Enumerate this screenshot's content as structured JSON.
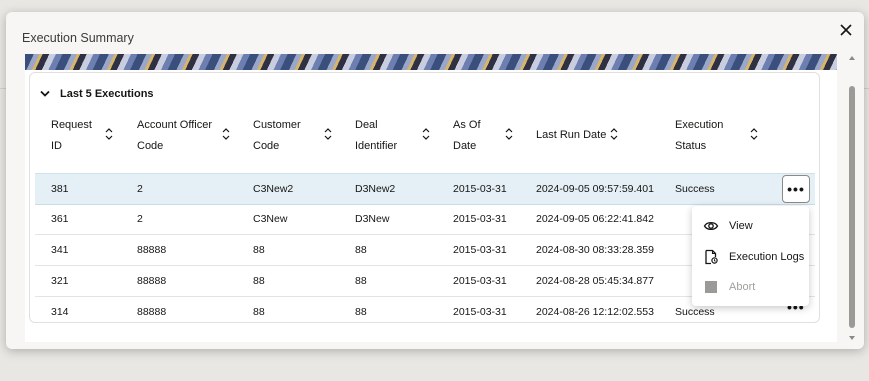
{
  "dialog": {
    "title": "Execution Summary",
    "section_title": "Last 5 Executions"
  },
  "table": {
    "columns": [
      {
        "label_line1": "Request",
        "label_line2": "ID"
      },
      {
        "label_line1": "Account Officer",
        "label_line2": "Code"
      },
      {
        "label_line1": "Customer",
        "label_line2": "Code"
      },
      {
        "label_line1": "Deal",
        "label_line2": "Identifier"
      },
      {
        "label_line1": "As Of",
        "label_line2": "Date"
      },
      {
        "label_line1": "Last Run Date",
        "label_line2": ""
      },
      {
        "label_line1": "Execution",
        "label_line2": "Status"
      }
    ],
    "rows": [
      {
        "request_id": "381",
        "account_officer_code": "2",
        "customer_code": "C3New2",
        "deal_identifier": "D3New2",
        "as_of_date": "2015-03-31",
        "last_run_date": "2024-09-05 09:57:59.401",
        "status": "Success",
        "selected": true
      },
      {
        "request_id": "361",
        "account_officer_code": "2",
        "customer_code": "C3New",
        "deal_identifier": "D3New",
        "as_of_date": "2015-03-31",
        "last_run_date": "2024-09-05 06:22:41.842",
        "status": ""
      },
      {
        "request_id": "341",
        "account_officer_code": "88888",
        "customer_code": "88",
        "deal_identifier": "88",
        "as_of_date": "2015-03-31",
        "last_run_date": "2024-08-30 08:33:28.359",
        "status": ""
      },
      {
        "request_id": "321",
        "account_officer_code": "88888",
        "customer_code": "88",
        "deal_identifier": "88",
        "as_of_date": "2015-03-31",
        "last_run_date": "2024-08-28 05:45:34.877",
        "status": ""
      },
      {
        "request_id": "314",
        "account_officer_code": "88888",
        "customer_code": "88",
        "deal_identifier": "88",
        "as_of_date": "2015-03-31",
        "last_run_date": "2024-08-26 12:12:02.553",
        "status": "Success"
      }
    ],
    "more_actions_glyph": "•••"
  },
  "context_menu": {
    "items": [
      {
        "label": "View",
        "icon": "eye-icon",
        "enabled": true
      },
      {
        "label": "Execution Logs",
        "icon": "log-document-icon",
        "enabled": true
      },
      {
        "label": "Abort",
        "icon": "abort-square-icon",
        "enabled": false
      }
    ]
  },
  "colors": {
    "selected_row": "#e5f0f6",
    "disabled_text": "#a19f9b"
  }
}
